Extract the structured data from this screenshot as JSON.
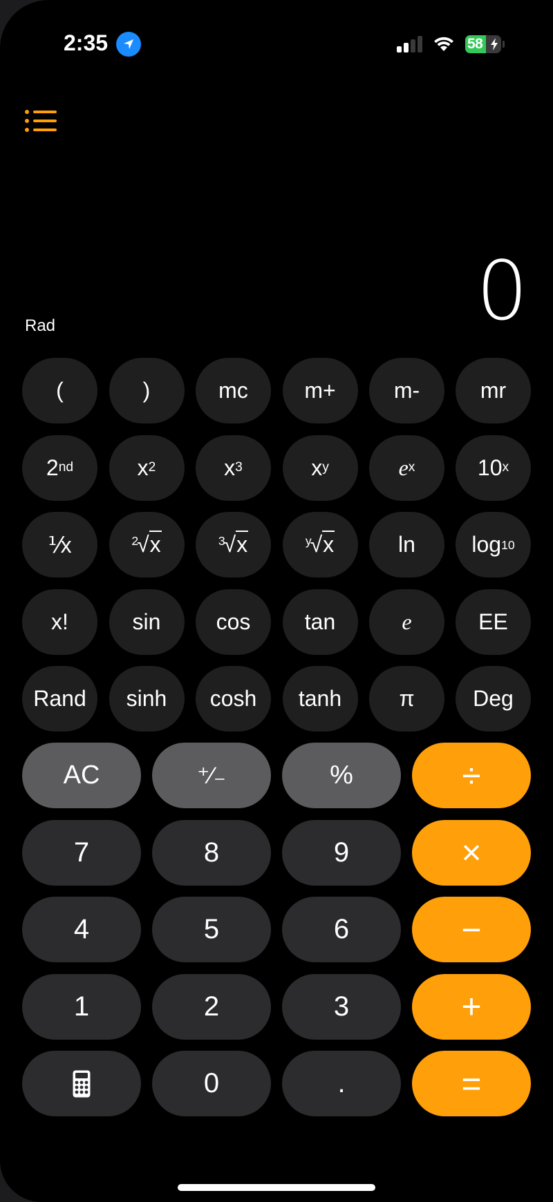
{
  "status_bar": {
    "time": "2:35",
    "location_icon": "location-arrow-icon",
    "signal_bars_active": 2,
    "signal_bars_total": 4,
    "wifi_icon": "wifi-icon",
    "battery_percent": 58,
    "battery_label": "58",
    "charging": true
  },
  "header": {
    "history_icon": "list-bullet-icon"
  },
  "display": {
    "angle_mode": "Rad",
    "value": "0"
  },
  "colors": {
    "accent": "#ff9f0a",
    "scientific_key": "#1f1f1f",
    "function_key": "#5c5c5e",
    "number_key": "#2c2c2e",
    "battery_green": "#34c759",
    "location_blue": "#1a8cff"
  },
  "scientific_keys": {
    "row1": [
      {
        "base": "("
      },
      {
        "base": ")"
      },
      {
        "base": "mc"
      },
      {
        "base": "m+"
      },
      {
        "base": "m-"
      },
      {
        "base": "mr"
      }
    ],
    "row2": [
      {
        "base": "2",
        "sup": "nd"
      },
      {
        "base": "x",
        "sup": "2"
      },
      {
        "base": "x",
        "sup": "3"
      },
      {
        "base": "x",
        "sup": "y"
      },
      {
        "base": "e",
        "sup": "x"
      },
      {
        "base": "10",
        "sup": "x"
      }
    ],
    "row3": [
      {
        "base": "⅟x",
        "label": "1/x"
      },
      {
        "index": "2",
        "radicand": "x"
      },
      {
        "index": "3",
        "radicand": "x"
      },
      {
        "index": "y",
        "radicand": "x"
      },
      {
        "base": "ln"
      },
      {
        "base": "log",
        "sub": "10"
      }
    ],
    "row4": [
      {
        "base": "x!"
      },
      {
        "base": "sin"
      },
      {
        "base": "cos"
      },
      {
        "base": "tan"
      },
      {
        "base": "e"
      },
      {
        "base": "EE"
      }
    ],
    "row5": [
      {
        "base": "Rand"
      },
      {
        "base": "sinh"
      },
      {
        "base": "cosh"
      },
      {
        "base": "tanh"
      },
      {
        "base": "π"
      },
      {
        "base": "Deg"
      }
    ]
  },
  "main_keys": {
    "row1": [
      "AC",
      "⁺∕₋",
      "%",
      "÷"
    ],
    "row2": [
      "7",
      "8",
      "9",
      "×"
    ],
    "row3": [
      "4",
      "5",
      "6",
      "−"
    ],
    "row4": [
      "1",
      "2",
      "3",
      "+"
    ],
    "row5": [
      "calculator-icon",
      "0",
      ".",
      "="
    ]
  }
}
